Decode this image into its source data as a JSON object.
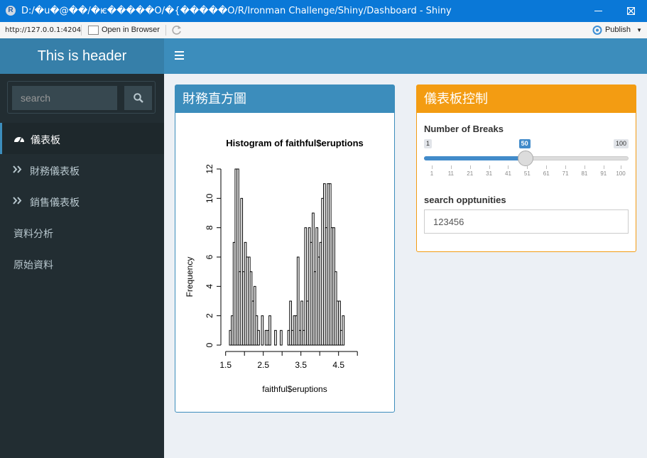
{
  "window": {
    "title": "D:/�u�@��/�ѥ�����O/�{�����O/R/Ironman Challenge/Shiny/Dashboard - Shiny",
    "app_icon": "R"
  },
  "addressbar": {
    "url": "http://127.0.0.1:4204",
    "open_in_browser": "Open in Browser",
    "publish": "Publish"
  },
  "header": {
    "title": "This is header"
  },
  "sidebar": {
    "search_placeholder": "search",
    "items": [
      {
        "label": "儀表板",
        "icon": "dashboard-icon",
        "active": true
      },
      {
        "label": "財務儀表板",
        "icon": "angle-double-right-icon"
      },
      {
        "label": "銷售儀表板",
        "icon": "angle-double-right-icon"
      },
      {
        "label": "資料分析"
      },
      {
        "label": "原始資料"
      }
    ]
  },
  "plot_box": {
    "title": "財務直方圖"
  },
  "control_box": {
    "title": "儀表板控制",
    "slider": {
      "label": "Number of Breaks",
      "min": 1,
      "max": 100,
      "value": 50,
      "min_label": "1",
      "max_label": "100",
      "value_label": "50",
      "ticks": [
        "1",
        "11",
        "21",
        "31",
        "41",
        "51",
        "61",
        "71",
        "81",
        "91",
        "100"
      ]
    },
    "text_input": {
      "label": "search opptunities",
      "value": "123456"
    }
  },
  "chart_data": {
    "type": "bar",
    "title": "Histogram of faithful$eruptions",
    "xlabel": "faithful$eruptions",
    "ylabel": "Frequency",
    "x_ticks": [
      "1.5",
      "2.5",
      "3.5",
      "4.5"
    ],
    "y_ticks": [
      "0",
      "2",
      "4",
      "6",
      "8",
      "10",
      "12"
    ],
    "xlim": [
      1.6,
      5.1
    ],
    "ylim": [
      0,
      12
    ],
    "bin_width": 0.05,
    "bin_start": 1.6,
    "values": [
      1,
      2,
      7,
      12,
      12,
      5,
      10,
      5,
      7,
      6,
      6,
      5,
      3,
      4,
      2,
      1,
      0,
      2,
      0,
      1,
      1,
      2,
      0,
      0,
      1,
      0,
      0,
      1,
      0,
      0,
      0,
      1,
      3,
      1,
      2,
      2,
      6,
      1,
      3,
      1,
      8,
      3,
      8,
      7,
      9,
      5,
      8,
      6,
      7,
      10,
      11,
      8,
      11,
      11,
      8,
      8,
      5,
      3,
      3,
      1,
      2
    ]
  }
}
